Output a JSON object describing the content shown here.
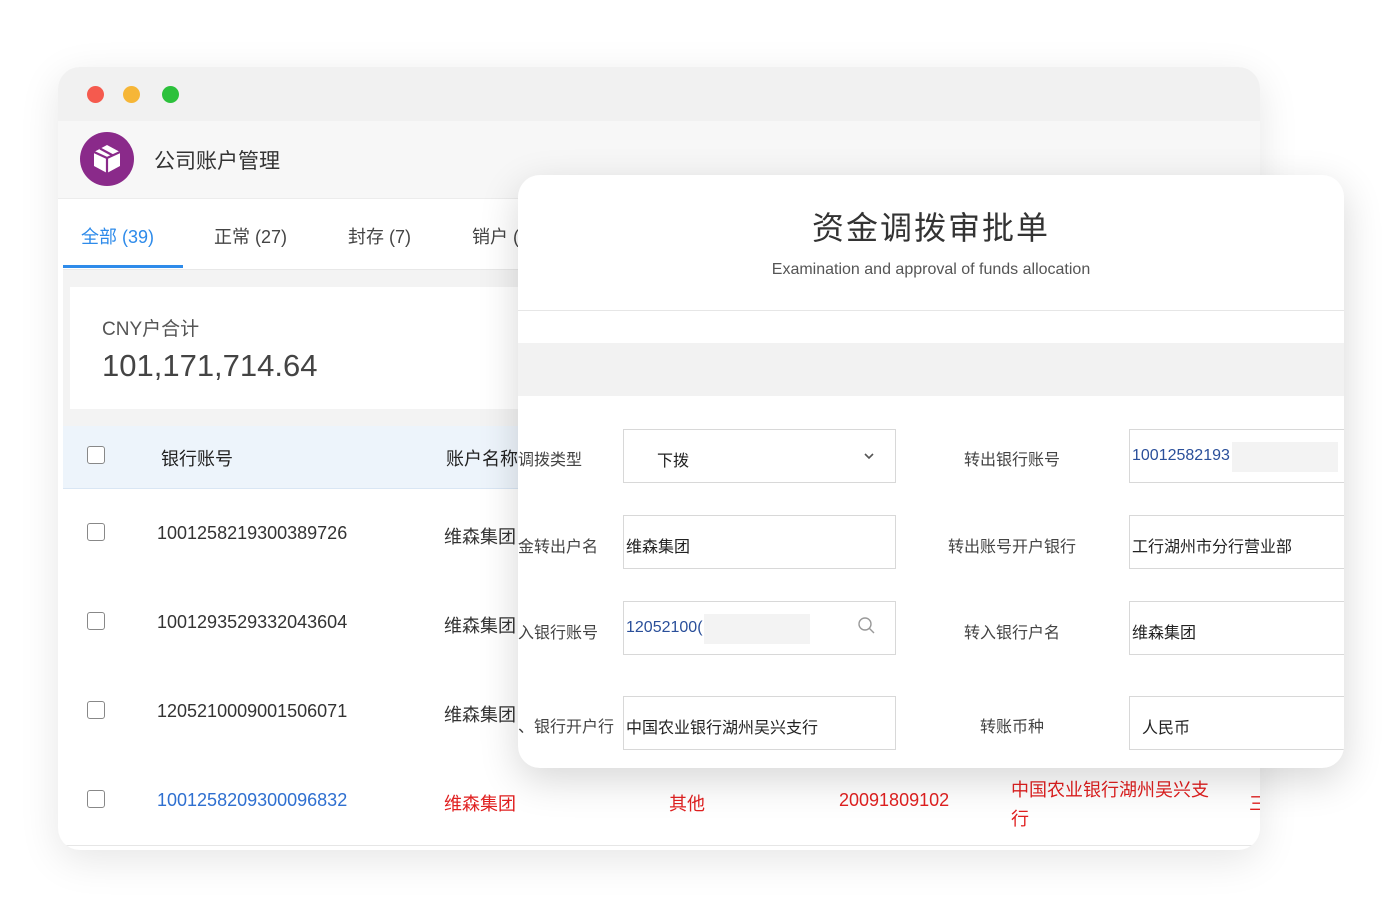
{
  "app": {
    "title": "公司账户管理"
  },
  "tabs": [
    {
      "label": "全部 (39)"
    },
    {
      "label": "正常 (27)"
    },
    {
      "label": "封存 (7)"
    },
    {
      "label": "销户 ("
    }
  ],
  "summary": {
    "label": "CNY户合计",
    "value": "101,171,714.64"
  },
  "table": {
    "headers": {
      "account": "银行账号",
      "name": "账户名称"
    },
    "rows": [
      {
        "account": "1001258219300389726",
        "name": "维森集团"
      },
      {
        "account": "1001293529332043604",
        "name": "维森集团"
      },
      {
        "account": "1205210009001506071",
        "name": "维森集团"
      },
      {
        "account": "1001258209300096832",
        "name": "维森集团",
        "type": "其他",
        "code": "20091809102",
        "bank_line1": "中国农业银行湖州吴兴支",
        "bank_line2": "行",
        "extra": "三"
      }
    ]
  },
  "dialog": {
    "title": "资金调拨审批单",
    "subtitle": "Examination and approval of funds allocation",
    "fields": {
      "transfer_type_label": "调拨类型",
      "transfer_type_value": "下拨",
      "out_account_label": "转出银行账号",
      "out_account_value": "10012582193",
      "out_name_label": "金转出户名",
      "out_name_value": "维森集团",
      "out_bank_label": "转出账号开户银行",
      "out_bank_value": "工行湖州市分行营业部",
      "in_account_label": "入银行账号",
      "in_account_value": "12052100(",
      "in_name_label": "转入银行户名",
      "in_name_value": "维森集团",
      "in_bank_label": "、银行开户行",
      "in_bank_value": "中国农业银行湖州吴兴支行",
      "currency_label": "转账币种",
      "currency_value": "人民币"
    }
  },
  "colors": {
    "accent": "#2e8bea",
    "highlight": "#e02020",
    "logo": "#8a2a8a"
  }
}
